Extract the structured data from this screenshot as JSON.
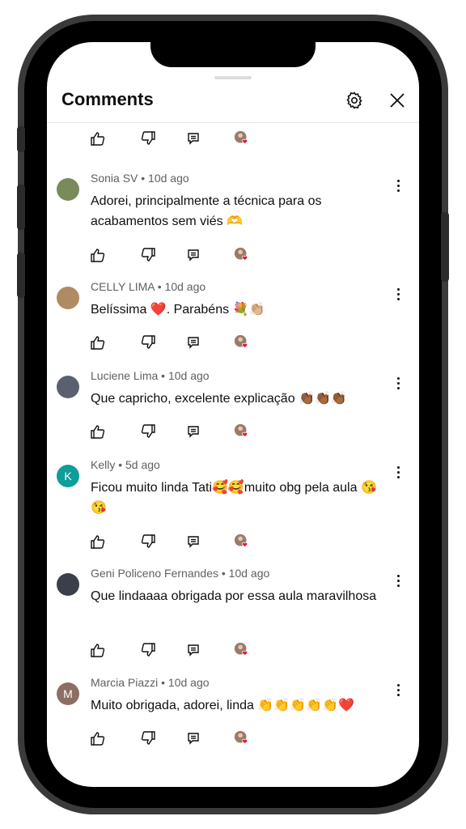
{
  "header": {
    "title": "Comments",
    "settings_icon": "gear-icon",
    "close_icon": "close-icon"
  },
  "comments": [
    {
      "author": "Sonia SV",
      "time": "10d ago",
      "meta": "Sonia SV • 10d ago",
      "text": "Adorei, principalmente a técnica para os acabamentos sem viés 🫶",
      "avatar_initial": "",
      "avatar_color": "#7a8a5a"
    },
    {
      "author": "CELLY LIMA",
      "time": "10d ago",
      "meta": "CELLY LIMA • 10d ago",
      "text": "Belíssima ❤️. Parabéns 💐👏🏼",
      "avatar_initial": "",
      "avatar_color": "#b08a60"
    },
    {
      "author": "Luciene Lima",
      "time": "10d ago",
      "meta": "Luciene Lima • 10d ago",
      "text": "Que capricho, excelente explicação 👏🏾👏🏾👏🏾",
      "avatar_initial": "",
      "avatar_color": "#5a6070"
    },
    {
      "author": "Kelly",
      "time": "5d ago",
      "meta": "Kelly • 5d ago",
      "text": "Ficou muito linda Tati🥰🥰muito obg pela aula 😘😘",
      "avatar_initial": "K",
      "avatar_color": "#0f9d9a"
    },
    {
      "author": "Geni Policeno Fernandes",
      "time": "10d ago",
      "meta": "Geni Policeno Fernandes • 10d ago",
      "text": "Que lindaaaa obrigada por essa aula maravilhosa",
      "avatar_initial": "",
      "avatar_color": "#3a3f4a"
    },
    {
      "author": "Marcia Piazzi",
      "time": "10d ago",
      "meta": "Marcia Piazzi • 10d ago",
      "text": "Muito obrigada, adorei, linda 👏👏👏👏👏❤️",
      "avatar_initial": "M",
      "avatar_color": "#8d6e63"
    }
  ],
  "action_icons": [
    "like-icon",
    "dislike-icon",
    "reply-icon",
    "creator-heart-icon"
  ]
}
